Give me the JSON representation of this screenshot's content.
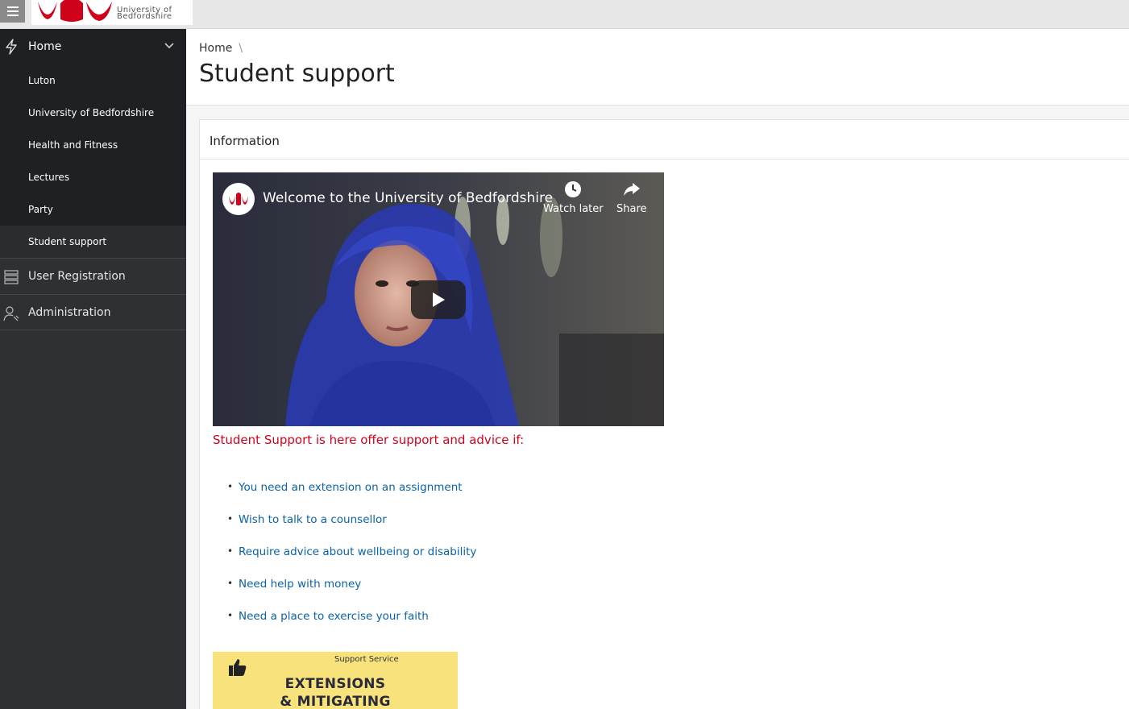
{
  "logo": {
    "line1": "University of",
    "line2": "Bedfordshire"
  },
  "sidebar": {
    "home_label": "Home",
    "sub_items": [
      {
        "label": "Luton"
      },
      {
        "label": "University of Bedfordshire"
      },
      {
        "label": "Health and Fitness"
      },
      {
        "label": "Lectures"
      },
      {
        "label": "Party"
      },
      {
        "label": "Student support"
      }
    ],
    "sections": [
      {
        "label": "User Registration"
      },
      {
        "label": "Administration"
      }
    ]
  },
  "breadcrumb": {
    "home": "Home",
    "separator": "\\"
  },
  "page_title": "Student support",
  "card": {
    "header": "Information",
    "video": {
      "title": "Welcome to the University of Bedfordshire",
      "watch_later": "Watch later",
      "share": "Share"
    },
    "intro": "Student Support is here offer support and advice if:",
    "items": [
      "You need an extension on an assignment",
      "Wish to talk to a counsellor",
      "Require advice about wellbeing or disability",
      "Need help with money",
      "Need a place to exercise your faith"
    ],
    "poster": {
      "service": "Support Service",
      "headline1": "EXTENSIONS",
      "headline2": "& MITIGATING"
    }
  },
  "colors": {
    "brand_red": "#d0021b",
    "sidebar_bg": "#2f3033",
    "link": "#0a62a8",
    "poster_bg": "#f7e27c"
  }
}
